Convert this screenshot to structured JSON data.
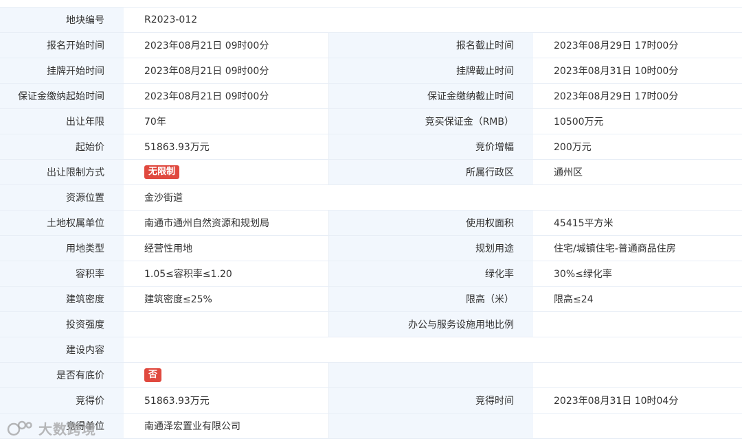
{
  "rows": [
    {
      "l1": "地块编号",
      "v1": "R2023-012",
      "l2": "",
      "v2": "",
      "span": true
    },
    {
      "l1": "报名开始时间",
      "v1": "2023年08月21日 09时00分",
      "l2": "报名截止时间",
      "v2": "2023年08月29日 17时00分"
    },
    {
      "l1": "挂牌开始时间",
      "v1": "2023年08月21日 09时00分",
      "l2": "挂牌截止时间",
      "v2": "2023年08月31日 10时00分"
    },
    {
      "l1": "保证金缴纳起始时间",
      "v1": "2023年08月21日 09时00分",
      "l2": "保证金缴纳截止时间",
      "v2": "2023年08月29日 17时00分"
    },
    {
      "l1": "出让年限",
      "v1": "70年",
      "l2": "竞买保证金（RMB）",
      "v2": "10500万元"
    },
    {
      "l1": "起始价",
      "v1": "51863.93万元",
      "l2": "竞价增幅",
      "v2": "200万元"
    },
    {
      "l1": "出让限制方式",
      "v1": "无限制",
      "badge1": true,
      "l2": "所属行政区",
      "v2": "通州区"
    },
    {
      "l1": "资源位置",
      "v1": "金沙街道",
      "span": true
    },
    {
      "l1": "土地权属单位",
      "v1": "南通市通州自然资源和规划局",
      "l2": "使用权面积",
      "v2": "45415平方米"
    },
    {
      "l1": "用地类型",
      "v1": "经营性用地",
      "l2": "规划用途",
      "v2": "住宅/城镇住宅-普通商品住房"
    },
    {
      "l1": "容积率",
      "v1": "1.05≤容积率≤1.20",
      "l2": "绿化率",
      "v2": "30%≤绿化率"
    },
    {
      "l1": "建筑密度",
      "v1": "建筑密度≤25%",
      "l2": "限高（米）",
      "v2": "限高≤24"
    },
    {
      "l1": "投资强度",
      "v1": "",
      "l2": "办公与服务设施用地比例",
      "v2": ""
    },
    {
      "l1": "建设内容",
      "v1": "",
      "span": true
    },
    {
      "l1": "是否有底价",
      "v1": "否",
      "badge1": true,
      "l2": "",
      "v2": ""
    },
    {
      "l1": "竞得价",
      "v1": "51863.93万元",
      "l2": "竞得时间",
      "v2": "2023年08月31日 10时04分"
    },
    {
      "l1": "竞得单位",
      "v1": "南通泽宏置业有限公司",
      "l2": "",
      "v2": ""
    }
  ],
  "watermark": {
    "text": "大数跨境",
    "icon": "brand-logo-icon"
  }
}
